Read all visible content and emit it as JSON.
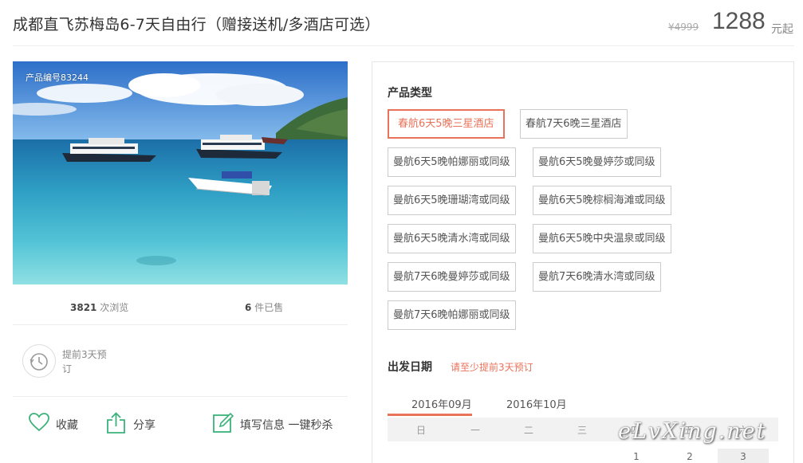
{
  "header": {
    "title": "成都直飞苏梅岛6-7天自由行（赠接送机/多酒店可选）",
    "old_price": "¥4999",
    "price": "1288",
    "price_unit": "元起"
  },
  "photo": {
    "product_id": "产品编号83244"
  },
  "stats": {
    "views_count": "3821",
    "views_label": "次浏览",
    "sold_count": "6",
    "sold_label": "件已售"
  },
  "advance": {
    "text": "提前3天预订"
  },
  "actions": {
    "favorite": "收藏",
    "share": "分享",
    "fill_info": "填写信息 一键秒杀"
  },
  "product_type": {
    "label": "产品类型",
    "options": [
      "春航6天5晚三星酒店",
      "春航7天6晚三星酒店",
      "曼航6天5晚帕娜丽或同级",
      "曼航6天5晚曼婷莎或同级",
      "曼航6天5晚珊瑚湾或同级",
      "曼航6天5晚棕榈海滩或同级",
      "曼航6天5晚清水湾或同级",
      "曼航6天5晚中央温泉或同级",
      "曼航7天6晚曼婷莎或同级",
      "曼航7天6晚清水湾或同级",
      "曼航7天6晚帕娜丽或同级"
    ],
    "selected_index": 0
  },
  "departure": {
    "label": "出发日期",
    "hint": "请至少提前3天预订",
    "months": [
      "2016年09月",
      "2016年10月"
    ],
    "active_month": 0,
    "weekdays": [
      "日",
      "一",
      "二",
      "三",
      "四",
      "五",
      "六"
    ],
    "visible_days": [
      "1",
      "2",
      "3"
    ]
  },
  "watermark": "eLvXing.net",
  "colors": {
    "accent": "#e8735a",
    "action_icon": "#3bb27a"
  }
}
